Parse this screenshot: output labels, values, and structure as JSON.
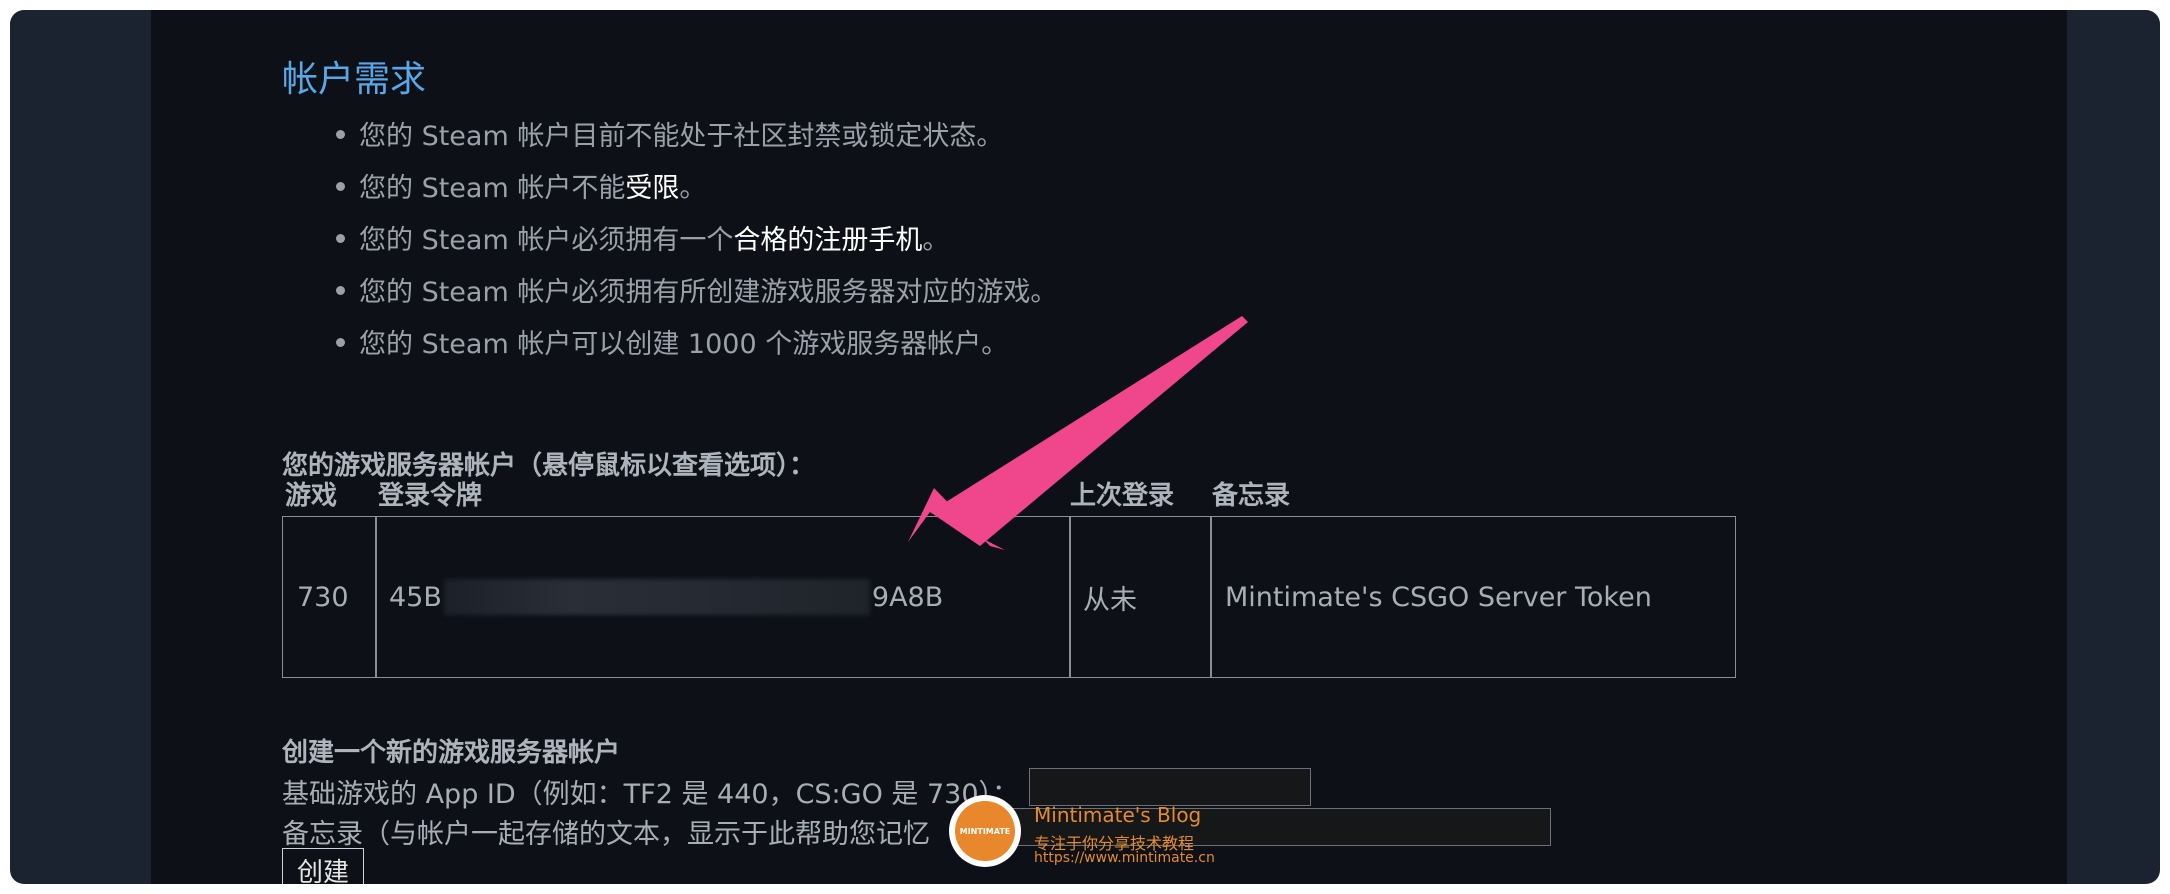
{
  "requirements": {
    "title": "帐户需求",
    "items": [
      {
        "pre": "您的 Steam 帐户目前不能处于社区封禁或锁定状态。",
        "hl": "",
        "post": ""
      },
      {
        "pre": "您的 Steam 帐户不能",
        "hl": "受限",
        "post": "。"
      },
      {
        "pre": "您的 Steam 帐户必须拥有一个",
        "hl": "合格的注册手机",
        "post": "。"
      },
      {
        "pre": "您的 Steam 帐户必须拥有所创建游戏服务器对应的游戏。",
        "hl": "",
        "post": ""
      },
      {
        "pre": "您的 Steam 帐户可以创建 1000 个游戏服务器帐户。",
        "hl": "",
        "post": ""
      }
    ]
  },
  "accounts": {
    "heading": "您的游戏服务器帐户（悬停鼠标以查看选项）：",
    "columns": {
      "game": "游戏",
      "token": "登录令牌",
      "last_login": "上次登录",
      "memo": "备忘录"
    },
    "rows": [
      {
        "game": "730",
        "token_start": "45B",
        "token_end": "9A8B",
        "last_login": "从未",
        "memo": "Mintimate's CSGO Server Token"
      }
    ]
  },
  "create_form": {
    "heading": "创建一个新的游戏服务器帐户",
    "appid_label": "基础游戏的 App ID（例如：TF2 是 440，CS:GO 是 730）：",
    "memo_label": "备忘录（与帐户一起存储的文本，显示于此帮助您记忆",
    "appid_value": "",
    "memo_value": "",
    "submit_label": "创建"
  },
  "watermark": {
    "title": "Mintimate's Blog",
    "subtitle": "专注于你分享技术教程",
    "url": "https://www.mintimate.cn",
    "logo_text": "MINTIMATE"
  },
  "colors": {
    "title_blue": "#5aa7e8",
    "arrow_pink": "#f0468c",
    "watermark_orange": "#e58a2d"
  }
}
